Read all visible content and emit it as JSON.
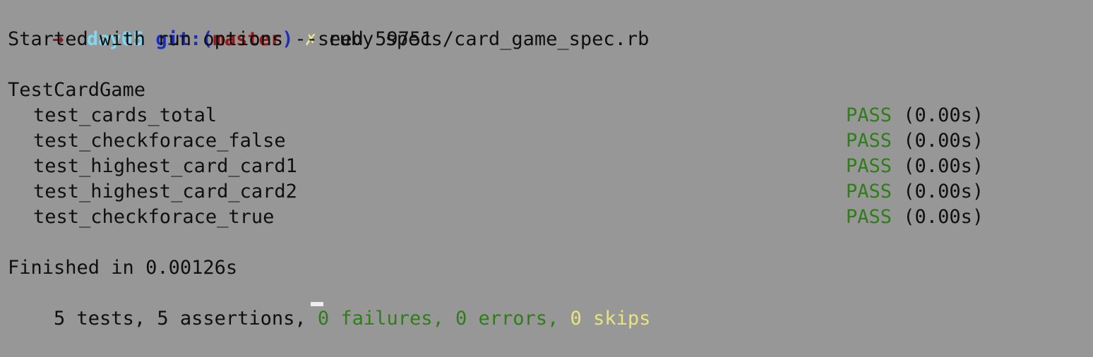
{
  "prompt": {
    "bracket": "[",
    "arrow": "→",
    "directory": "day05",
    "git_prefix": "git:(",
    "branch": "master",
    "git_suffix": ")",
    "dirty_marker": "✗",
    "command": "ruby specs/card_game_spec.rb"
  },
  "run_options": "Started with run options --seed 59751",
  "suite_name": "TestCardGame",
  "tests": [
    {
      "name": "test_cards_total",
      "status": "PASS",
      "time": "(0.00s)"
    },
    {
      "name": "test_checkforace_false",
      "status": "PASS",
      "time": "(0.00s)"
    },
    {
      "name": "test_highest_card_card1",
      "status": "PASS",
      "time": "(0.00s)"
    },
    {
      "name": "test_highest_card_card2",
      "status": "PASS",
      "time": "(0.00s)"
    },
    {
      "name": "test_checkforace_true",
      "status": "PASS",
      "time": "(0.00s)"
    }
  ],
  "finished": "Finished in 0.00126s",
  "summary": {
    "prefix": "5 tests, 5 assertions, ",
    "failures": "0 failures, ",
    "errors": "0 errors, ",
    "skips": "0 skips"
  },
  "colors": {
    "background": "#979797",
    "pass": "#2f7d18",
    "skips": "#e8e57a",
    "directory": "#7fd7f2",
    "git": "#1e2fb7",
    "branch": "#9a1717"
  }
}
